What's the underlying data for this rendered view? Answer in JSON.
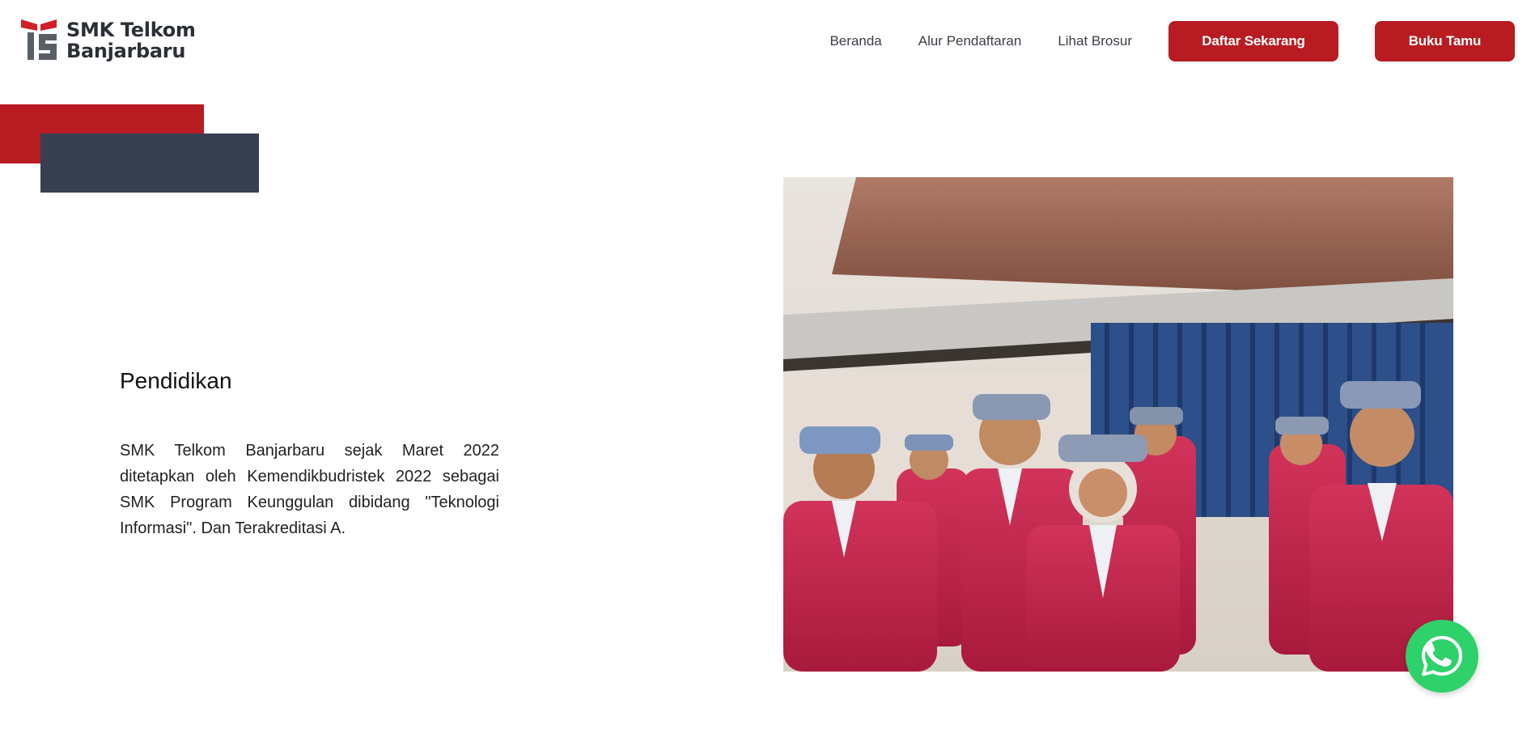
{
  "brand": {
    "name_line1": "SMK Telkom",
    "name_line2": "Banjarbaru",
    "logo_icon": "smk-telkom-logo",
    "colors": {
      "primary": "#b81c22",
      "slate": "#373f50"
    }
  },
  "nav": {
    "links": [
      {
        "label": "Beranda"
      },
      {
        "label": "Alur Pendaftaran"
      },
      {
        "label": "Lihat Brosur"
      }
    ],
    "cta_primary": "Daftar Sekarang",
    "cta_secondary": "Buku Tamu"
  },
  "section": {
    "title": "Pendidikan",
    "body": "SMK Telkom Banjarbaru sejak Maret 2022 ditetapkan oleh Kemendikbudristek 2022 sebagai SMK Program Keunggulan dibidang \"Teknologi Informasi\". Dan Terakreditasi A."
  },
  "floating": {
    "icon": "whatsapp-icon",
    "color": "#2fd16a"
  }
}
